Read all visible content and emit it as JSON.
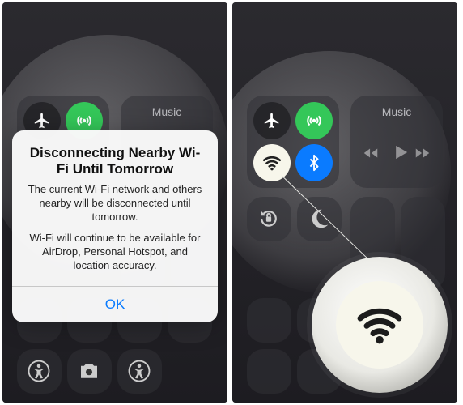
{
  "left": {
    "spotlight": true,
    "connectivity": {
      "airplane": {
        "state": "off"
      },
      "cellular": {
        "state": "on",
        "color_on": "#34c759"
      },
      "wifi": {
        "state": "disconnected"
      },
      "bluetooth": {
        "state": "on",
        "color_on": "#0a7bff"
      }
    },
    "music": {
      "label": "Music"
    },
    "alert": {
      "title": "Disconnecting Nearby Wi-Fi Until Tomorrow",
      "body1": "The current Wi-Fi network and others nearby will be disconnected until tomorrow.",
      "body2": "Wi-Fi will continue to be available for AirDrop, Personal Hotspot, and location accuracy.",
      "ok_label": "OK"
    },
    "row3_icons": [
      "flashlight-icon",
      "timer-icon",
      "calculator-icon",
      "camera-icon",
      "accessibility-icon"
    ]
  },
  "right": {
    "spotlight": true,
    "connectivity": {
      "airplane": {
        "state": "off"
      },
      "cellular": {
        "state": "on",
        "color_on": "#34c759"
      },
      "wifi": {
        "state": "disconnected_highlighted"
      },
      "bluetooth": {
        "state": "on",
        "color_on": "#0a7bff"
      }
    },
    "music": {
      "label": "Music"
    },
    "callout": {
      "icon": "wifi-icon"
    }
  }
}
